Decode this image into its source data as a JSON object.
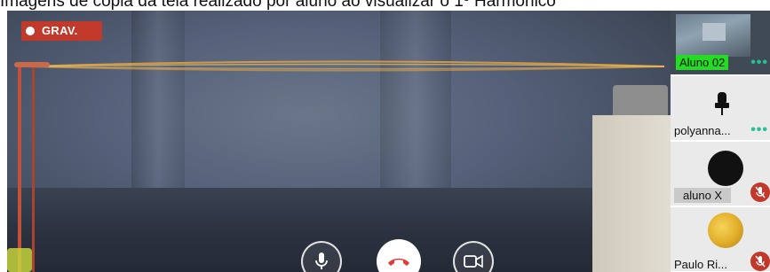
{
  "caption": "Imagens de cópia da tela realizado por aluno ao visualizar o 1º Harmônico",
  "recording": {
    "label": "GRAV."
  },
  "controls": {
    "mic": {
      "icon": "microphone-icon"
    },
    "hangup": {
      "icon": "phone-hangup-icon",
      "color": "#e53935"
    },
    "camera": {
      "icon": "video-camera-icon"
    }
  },
  "participants": [
    {
      "name": "Aluno 02",
      "more": "•••",
      "highlight_color": "#22dd22"
    },
    {
      "name": "polyanna...",
      "more": "•••"
    },
    {
      "name": "aluno X",
      "muted": true
    },
    {
      "name": "Paulo Ri...",
      "muted": true
    }
  ],
  "colors": {
    "record_badge": "#c0392b",
    "mute_badge": "#c0392b",
    "more_dots": "#27c093"
  }
}
